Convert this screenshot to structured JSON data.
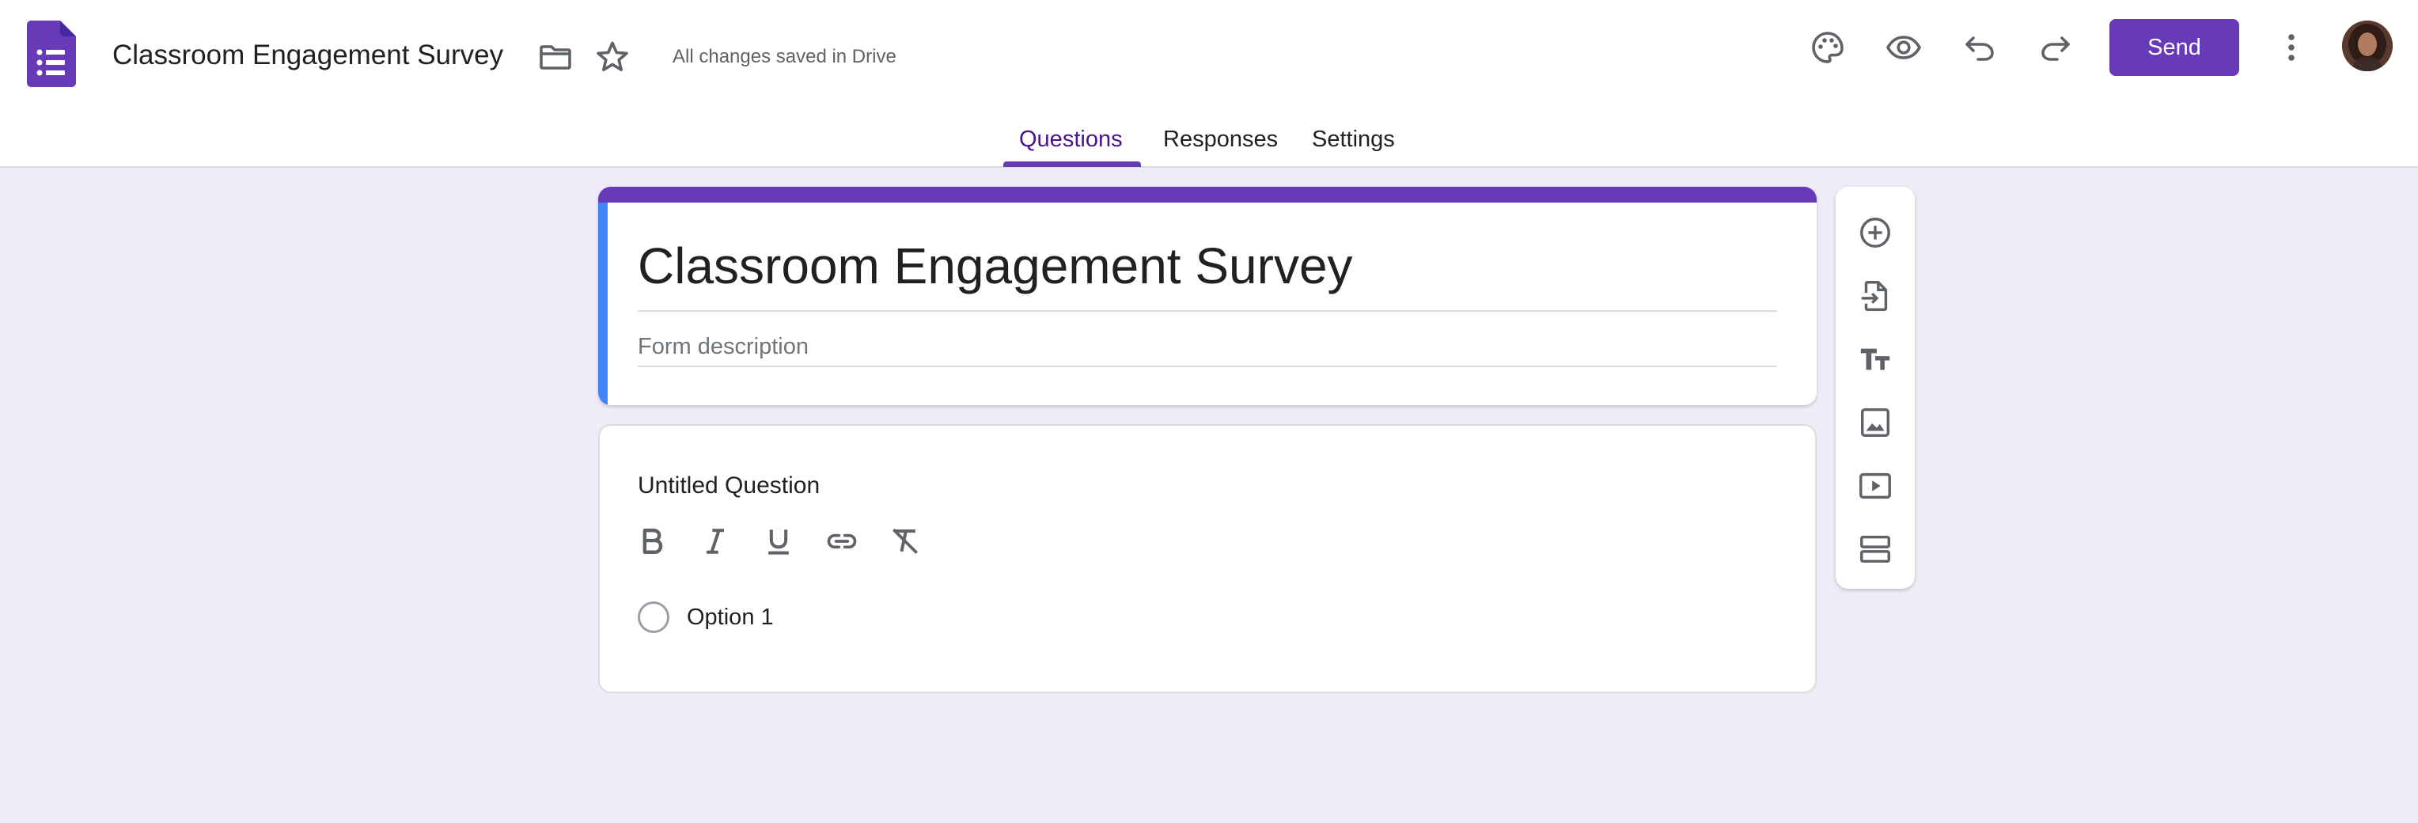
{
  "header": {
    "doc_title": "Classroom Engagement Survey",
    "save_status": "All changes saved in Drive",
    "send_label": "Send",
    "icons": [
      "forms-logo-icon",
      "folder-icon",
      "star-icon",
      "palette-icon",
      "preview-eye-icon",
      "undo-icon",
      "redo-icon",
      "more-vert-icon",
      "avatar"
    ]
  },
  "tabs": [
    {
      "label": "Questions",
      "active": true
    },
    {
      "label": "Responses",
      "active": false
    },
    {
      "label": "Settings",
      "active": false
    }
  ],
  "form": {
    "title": "Classroom Engagement Survey",
    "description_placeholder": "Form description"
  },
  "question": {
    "title": "Untitled Question",
    "format_tools": [
      "bold-icon",
      "italic-icon",
      "underline-icon",
      "link-icon",
      "clear-format-icon"
    ],
    "options": [
      {
        "label": "Option 1"
      }
    ]
  },
  "side_toolbar": {
    "tools": [
      "add-question-icon",
      "import-questions-icon",
      "add-title-icon",
      "add-image-icon",
      "add-video-icon",
      "add-section-icon"
    ]
  },
  "colors": {
    "brand": "#673ab7",
    "accent_blue": "#4285f4",
    "background": "#efebf7",
    "icon": "#5f6368"
  }
}
